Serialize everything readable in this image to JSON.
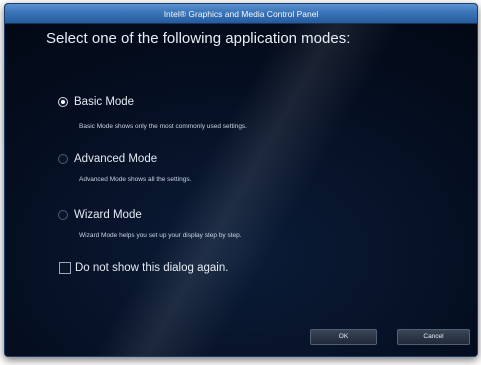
{
  "window": {
    "title": "Intel® Graphics and Media Control Panel"
  },
  "heading": "Select one of the following application modes:",
  "modes": [
    {
      "label": "Basic Mode",
      "description": "Basic Mode shows only the most commonly used settings.",
      "selected": true
    },
    {
      "label": "Advanced Mode",
      "description": "Advanced Mode shows all the settings.",
      "selected": false
    },
    {
      "label": "Wizard Mode",
      "description": "Wizard Mode helps you set up your display step by step.",
      "selected": false
    }
  ],
  "checkbox": {
    "label": "Do not show this dialog again.",
    "checked": false
  },
  "buttons": {
    "ok": "OK",
    "cancel": "Cancel"
  }
}
